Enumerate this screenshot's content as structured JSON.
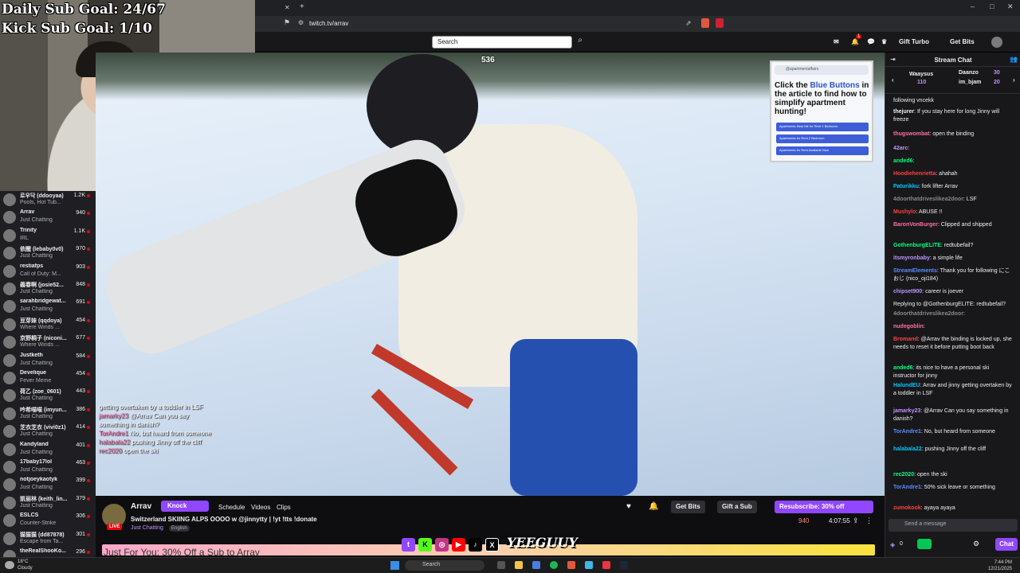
{
  "overlay": {
    "goal1": "Daily Sub Goal: 24/67",
    "goal2": "Kick Sub Goal: 1/10"
  },
  "browser": {
    "url": "twitch.tv/arrav"
  },
  "twitch_top": {
    "search_placeholder": "Search",
    "gift_turbo": "Gift Turbo",
    "get_bits": "Get Bits",
    "notif_count": "1"
  },
  "sidebar": {
    "items": [
      {
        "name": "로우닥 (ddooyaa)",
        "game": "Pools, Hot Tub...",
        "viewers": "1.2K"
      },
      {
        "name": "Arrav",
        "game": "Just Chatting",
        "viewers": "940"
      },
      {
        "name": "Trinity",
        "game": "IRL",
        "viewers": "1.1K"
      },
      {
        "name": "依醒 (lebaby0v0)",
        "game": "Just Chatting",
        "viewers": "970"
      },
      {
        "name": "restiafps",
        "game": "Call of Duty: M...",
        "viewers": "903"
      },
      {
        "name": "義春啊 (josie52...",
        "game": "Just Chatting",
        "viewers": "848"
      },
      {
        "name": "sarahbridgewat...",
        "game": "Just Chatting",
        "viewers": "691"
      },
      {
        "name": "豆芽妹 (qqdoya)",
        "game": "Where Winds ...",
        "viewers": "454"
      },
      {
        "name": "京野桐子 (niconi...",
        "game": "Where Winds ...",
        "viewers": "677"
      },
      {
        "name": "Justketh",
        "game": "Just Chatting",
        "viewers": "584"
      },
      {
        "name": "Develique",
        "game": "Fever Meme",
        "viewers": "454"
      },
      {
        "name": "荷乙 (zoe_0601)",
        "game": "Just Chatting",
        "viewers": "443"
      },
      {
        "name": "吟希喵喵 (imyun...",
        "game": "Just Chatting",
        "viewers": "386"
      },
      {
        "name": "芝衣芝衣 (vivi0z1)",
        "game": "Just Chatting",
        "viewers": "414"
      },
      {
        "name": "Kandyland",
        "game": "Just Chatting",
        "viewers": "401"
      },
      {
        "name": "17baby17lol",
        "game": "Just Chatting",
        "viewers": "463"
      },
      {
        "name": "notjoeykaotyk",
        "game": "Just Chatting",
        "viewers": "399"
      },
      {
        "name": "凯丽林 (keith_lin...",
        "game": "Just Chatting",
        "viewers": "379"
      },
      {
        "name": "ESLCS",
        "game": "Counter-Strike",
        "viewers": "306"
      },
      {
        "name": "猫猫猫 (dd87878)",
        "game": "Escape from Ta...",
        "viewers": "301"
      },
      {
        "name": "theRealShooKo...",
        "game": "",
        "viewers": "296"
      }
    ]
  },
  "video": {
    "viewer_overlay": "536",
    "ad": {
      "header": "@apartmentaffairs",
      "line1": "Click the ",
      "line1_blue": "Blue Buttons",
      "line2": " in the article to find how to simplify apartment hunting!",
      "buttons": [
        "Apartments Near Me for Rent 1 Bedroom",
        "Apartments for Rent 2 Bedroom",
        "Apartments for Rent Available Now"
      ]
    },
    "overlay_chat": [
      {
        "user": "",
        "text": "getting overtaken by a toddler in LSF"
      },
      {
        "user": "jamarky23",
        "text": " @Arrav Can you say something in danish?"
      },
      {
        "user": "TorAndre1",
        "text": " No, but heard from someone"
      },
      {
        "user": "halabala22",
        "text": " pushing Jinny off the cliff"
      },
      {
        "user": "rec2020",
        "text": " open the ski"
      }
    ]
  },
  "info": {
    "channel": "Arrav",
    "knock": "Knock",
    "tabs": [
      "Schedule",
      "Videos",
      "Clips"
    ],
    "title": "Switzerland SKIING ALPS OOOO w @jinnytty | !yt !tts !donate",
    "category": "Just Chatting",
    "language": "English",
    "live": "LIVE",
    "get_bits": "Get Bits",
    "gift_sub": "Gift a Sub",
    "resub": "Resubscribe: 30% off",
    "viewers": "940",
    "uptime": "4:07:55",
    "banner": "Just For You: 30% Off a Sub to Arrav"
  },
  "brand": "YEEGUUY",
  "chat": {
    "title": "Stream Chat",
    "leaderboard": [
      {
        "name": "Waaysus",
        "score": "110"
      },
      {
        "name": "Daanzo",
        "score": "30"
      },
      {
        "name": "im_bjam",
        "score": "20"
      }
    ],
    "messages": [
      {
        "user": "",
        "color": "#efeff1",
        "text": "following vncekk"
      },
      {
        "user": "thejurer",
        "color": "#efeff1",
        "text": ": If you stay here for long Jinny will freeze"
      },
      {
        "user": "thugswombat",
        "color": "#ff6ea8",
        "text": ": open the binding"
      },
      {
        "user": "42arc",
        "color": "#bf94ff",
        "text": ":"
      },
      {
        "user": "anded6",
        "color": "#00ff7f",
        "text": ":"
      },
      {
        "user": "Hoodiehenrietta",
        "color": "#ff4040",
        "text": ": ahahah"
      },
      {
        "user": "Paturikku",
        "color": "#00c8ff",
        "text": ": fork lifter Arrav"
      },
      {
        "user": "4doorthatdriveslikea2door",
        "color": "#888",
        "text": ": LSF"
      },
      {
        "user": "Mushylo",
        "color": "#ff4040",
        "text": ": ABUSE !!"
      },
      {
        "user": "BaronVonBurger",
        "color": "#ff6ea8",
        "text": ": Clipped and shipped"
      },
      {
        "user": "GothenburgELITE",
        "color": "#00ff7f",
        "text": ": redtubefail?"
      },
      {
        "user": "itsmyronbaby",
        "color": "#bf94ff",
        "text": ": a simple life"
      },
      {
        "user": "StreamElements",
        "color": "#5c8cff",
        "text": ": Thank you for following にこおじ (nico_oji184)"
      },
      {
        "user": "chipset900",
        "color": "#bf94ff",
        "text": ": career is joever"
      },
      {
        "user": "",
        "color": "#adadb8",
        "text": "Replying to @GothenburgELITE: redtubefail?"
      },
      {
        "user": "4doorthatdriveslikea2door",
        "color": "#888",
        "text": ":"
      },
      {
        "user": "nudegoblin",
        "color": "#ff6ea8",
        "text": ":"
      },
      {
        "user": "Bromand",
        "color": "#ff4040",
        "text": ": @Arrav the binding is locked up, she needs to reset it before putting boot back"
      },
      {
        "user": "anded6",
        "color": "#00ff7f",
        "text": ": its nice to have a personal ski instructor for jinny"
      },
      {
        "user": "HalundEU",
        "color": "#00c8ff",
        "text": ": Arrav and jinny getting overtaken by a toddler in LSF"
      },
      {
        "user": "jamarky23",
        "color": "#bf94ff",
        "text": ": @Arrav Can you say something in danish?"
      },
      {
        "user": "TorAndre1",
        "color": "#5c8cff",
        "text": ": No, but heard from someone"
      },
      {
        "user": "halabala22",
        "color": "#00c8ff",
        "text": ": pushing Jinny off the cliff"
      },
      {
        "user": "rec2020",
        "color": "#00ff7f",
        "text": ": open the ski"
      },
      {
        "user": "TorAndre1",
        "color": "#5c8cff",
        "text": ": 50% sick leave or something"
      },
      {
        "user": "zumokook",
        "color": "#ff4040",
        "text": ": ayaya ayaya"
      }
    ],
    "send_placeholder": "Send a message",
    "chat_button": "Chat",
    "points": "0"
  },
  "taskbar": {
    "temp": "18°C",
    "weather": "Cloudy",
    "search": "Search",
    "time": "7:44 PM",
    "date": "12/21/2025"
  }
}
